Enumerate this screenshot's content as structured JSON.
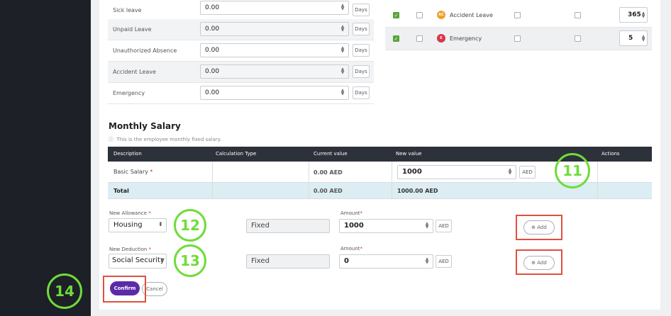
{
  "leave_rows": [
    {
      "label": "Sick leave",
      "value": "0.00",
      "unit": "Days"
    },
    {
      "label": "Unpaid Leave",
      "value": "0.00",
      "unit": "Days"
    },
    {
      "label": "Unauthorized Absence",
      "value": "0.00",
      "unit": "Days"
    },
    {
      "label": "Accident Leave",
      "value": "0.00",
      "unit": "Days"
    },
    {
      "label": "Emergency",
      "value": "0.00",
      "unit": "Days"
    }
  ],
  "right_leave_table": [
    {
      "badge": "AC",
      "badge_color": "#f0a030",
      "name": "Accident Leave",
      "value": "365",
      "checked": true
    },
    {
      "badge": "E",
      "badge_color": "#d8364a",
      "name": "Emergency",
      "value": "5",
      "checked": true
    }
  ],
  "monthly_salary": {
    "title": "Monthly Salary",
    "description": "This is the employee monthly fixed salary.",
    "columns": [
      "Description",
      "Calculation Type",
      "Current value",
      "New value",
      "Actions"
    ],
    "rows": [
      {
        "description": "Basic Salary",
        "required": "*",
        "calc_type": "",
        "current_value": "0.00 AED",
        "new_value": "1000",
        "new_unit": "AED"
      }
    ],
    "total": {
      "label": "Total",
      "current_value": "0.00 AED",
      "new_value": "1000.00 AED"
    }
  },
  "allowance": {
    "label": "New Allowance",
    "selected": "Housing",
    "type": "Fixed",
    "amount_label": "Amount",
    "amount": "1000",
    "unit": "AED",
    "add_label": "Add"
  },
  "deduction": {
    "label": "New Deduction",
    "selected": "Social Security",
    "type": "Fixed",
    "amount_label": "Amount",
    "amount": "0",
    "unit": "AED",
    "add_label": "Add"
  },
  "required_mark": "*",
  "buttons": {
    "confirm": "Confirm",
    "cancel": "Cancel"
  },
  "annotations": {
    "n11": "11",
    "n12": "12",
    "n13": "13",
    "n14": "14",
    "color": "#6fdc3a",
    "box_color": "#e0503f"
  }
}
